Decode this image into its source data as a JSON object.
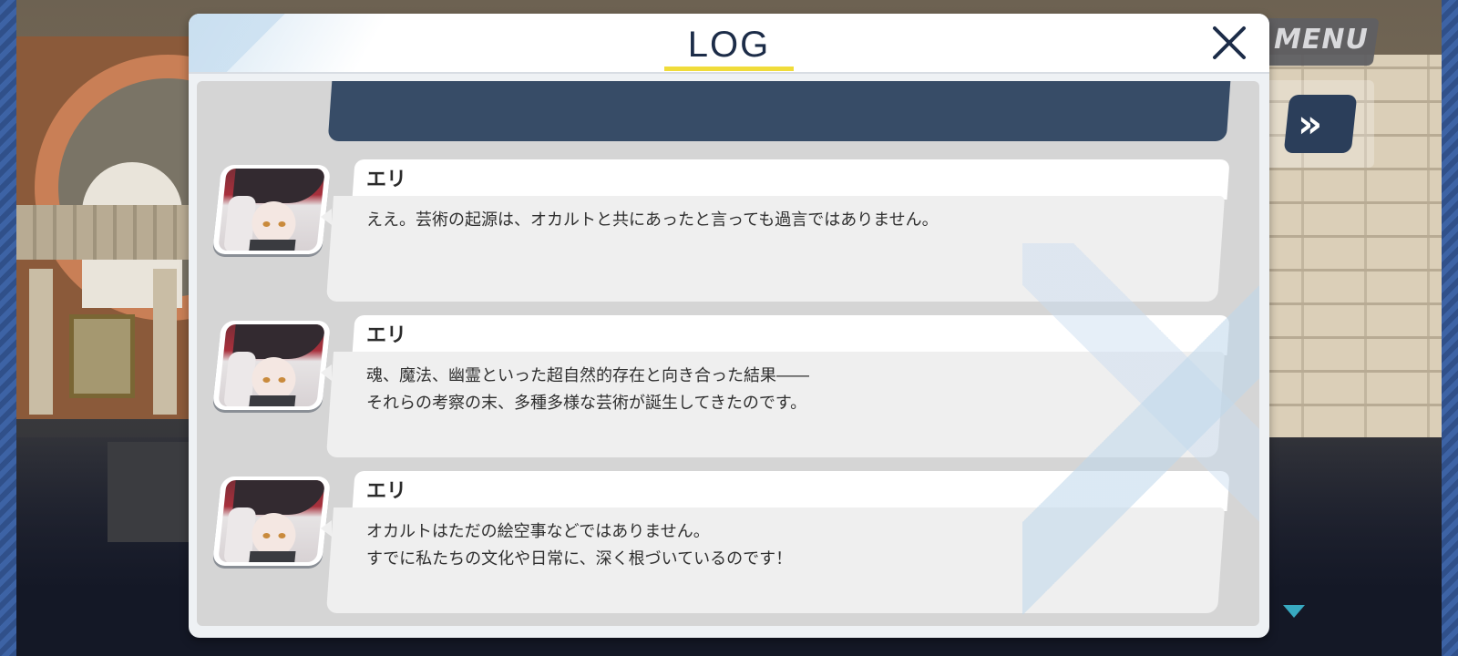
{
  "menu": {
    "label": "MENU",
    "fast_forward_glyph": "»"
  },
  "dialog": {
    "title": "LOG",
    "close_glyph": "×"
  },
  "entries": [
    {
      "speaker": "エリ",
      "lines": [
        "ええ。芸術の起源は、オカルトと共にあったと言っても過言ではありません。",
        ""
      ]
    },
    {
      "speaker": "エリ",
      "lines": [
        "魂、魔法、幽霊といった超自然的存在と向き合った結果――",
        "それらの考察の末、多種多様な芸術が誕生してきたのです。"
      ]
    },
    {
      "speaker": "エリ",
      "lines": [
        "オカルトはただの絵空事などではありません。",
        "すでに私たちの文化や日常に、深く根づいているのです！"
      ]
    }
  ],
  "colors": {
    "accent_underline": "#f0dc3a",
    "bubble_dark": "#374c67",
    "title": "#1c2c48"
  }
}
